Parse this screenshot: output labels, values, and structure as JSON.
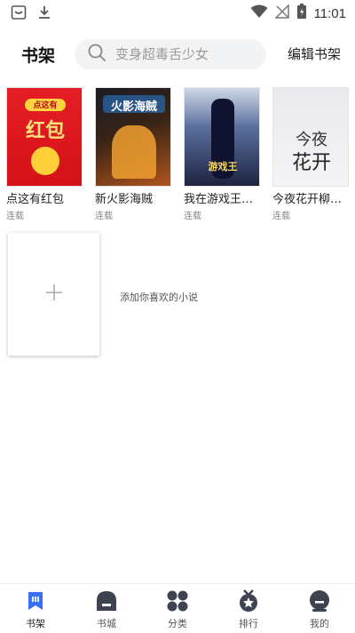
{
  "statusbar": {
    "time": "11:01",
    "icons": [
      "app-notification-icon",
      "download-icon",
      "wifi-icon",
      "no-signal-icon",
      "battery-icon"
    ]
  },
  "header": {
    "title": "书架",
    "search_placeholder": "变身超毒舌少女",
    "edit_label": "编辑书架"
  },
  "books": [
    {
      "title": "点这有红包",
      "status": "连载",
      "cover_text": "点这有",
      "cover_text2": "红包"
    },
    {
      "title": "新火影海贼",
      "status": "连载",
      "cover_text": "火影海贼"
    },
    {
      "title": "我在游戏王…",
      "status": "连载",
      "cover_text": "游戏王"
    },
    {
      "title": "今夜花开柳…",
      "status": "连载",
      "cover_text": "今夜",
      "cover_text2": "花开"
    }
  ],
  "add_card": {
    "label": "添加你喜欢的小说"
  },
  "bottom_nav": [
    {
      "label": "书架",
      "icon": "bookshelf-icon",
      "active": true
    },
    {
      "label": "书城",
      "icon": "bookstore-icon",
      "active": false
    },
    {
      "label": "分类",
      "icon": "category-icon",
      "active": false
    },
    {
      "label": "排行",
      "icon": "ranking-icon",
      "active": false
    },
    {
      "label": "我的",
      "icon": "profile-icon",
      "active": false
    }
  ],
  "colors": {
    "accent": "#3a6ff7",
    "text": "#222222",
    "muted": "#888888"
  }
}
